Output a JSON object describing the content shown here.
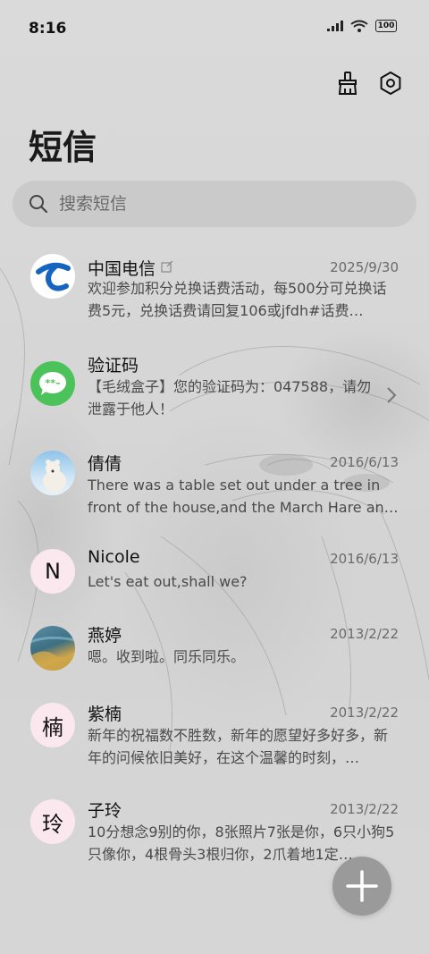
{
  "status": {
    "time": "8:16",
    "battery": "100"
  },
  "page_title": "短信",
  "search": {
    "placeholder": "搜索短信"
  },
  "conversations": [
    {
      "name": "中国电信",
      "date": "2025/9/30",
      "preview": "欢迎参加积分兑换话费活动，每500分可兑换话费5元，兑换话费请回复106或jfdh#话费…",
      "avatar": "china-telecom-logo"
    },
    {
      "name": "验证码",
      "date": "",
      "preview": "【毛绒盒子】您的验证码为：047588，请勿泄露于他人！",
      "avatar": "verification-code-icon"
    },
    {
      "name": "倩倩",
      "date": "2016/6/13",
      "preview": "There was a table set out under a tree in front of the house,and the March Hare an…",
      "avatar": "polar-bear-photo"
    },
    {
      "name": "Nicole",
      "date": "2016/6/13",
      "preview": "Let's eat out,shall we?",
      "avatar_letter": "N"
    },
    {
      "name": "燕婷",
      "date": "2013/2/22",
      "preview": "嗯。收到啦。同乐同乐。",
      "avatar": "landscape-photo"
    },
    {
      "name": "紫楠",
      "date": "2013/2/22",
      "preview": "新年的祝福数不胜数，新年的愿望好多好多，新年的问候依旧美好，在这个温馨的时刻，…",
      "avatar_letter": "楠"
    },
    {
      "name": "子玲",
      "date": "2013/2/22",
      "preview": "10分想念9别的你，8张照片7张是你，6只小狗5只像你，4根骨头3根归你，2爪着地1定…",
      "avatar_letter": "玲"
    }
  ],
  "colors": {
    "accent_green": "#4cc35a",
    "telecom_blue": "#1565c0",
    "letter_avatar_bg": "#fbe8ef"
  }
}
